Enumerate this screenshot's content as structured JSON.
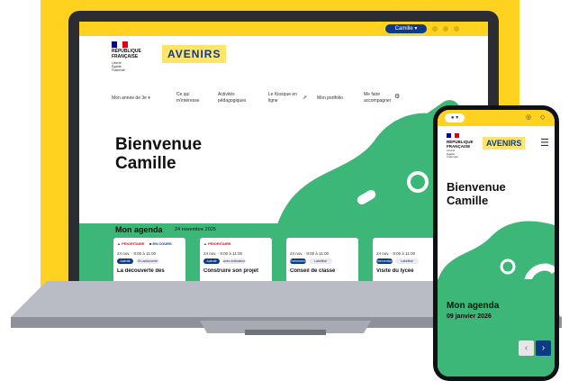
{
  "laptop": {
    "user_chip": "Camille ▾",
    "brand": {
      "line1": "RÉPUBLIQUE",
      "line2": "FRANÇAISE",
      "motto": "Liberté Égalité Fraternité",
      "app_logo": "AVENIRS"
    },
    "nav": {
      "item1": "Mon année de 3e ▾",
      "item2a": "Ce qui",
      "item2b": "m'intéresse",
      "item3a": "Activités",
      "item3b": "pédagogiques",
      "item4a": "Le Kiosque en",
      "item4b": "ligne",
      "item5": "Mon portfolio",
      "item6a": "Me faire",
      "item6b": "accompagner"
    },
    "welcome_line1": "Bienvenue",
    "welcome_line2": "Camille",
    "agenda": {
      "title": "Mon agenda",
      "date": "24 novembre 2025",
      "cards": [
        {
          "tag": "▲ PRIORITAIRE",
          "tag2": "■ EN COURS",
          "time": "24 nov. · 8:00 à 11:00",
          "pill1": "Activité",
          "pill2": "En autonomie",
          "title": "La découverte des"
        },
        {
          "tag": "▲ PRIORITAIRE",
          "tag2": "",
          "time": "24 nov. · 8:00 à 11:00",
          "pill1": "Activité",
          "pill2": "avec ordinateur",
          "title": "Construire son projet"
        },
        {
          "tag": "",
          "tag2": "",
          "time": "24 nov. · 8:00 à 11:00",
          "pill1": "Événement",
          "pill2": "Labellisé",
          "title": "Conseil de classe"
        },
        {
          "tag": "",
          "tag2": "",
          "time": "24 nov. · 8:00 à 11:00",
          "pill1": "Intervention",
          "pill2": "Labellisé",
          "title": "Visite du lycée"
        }
      ]
    }
  },
  "phone": {
    "brand": {
      "line1": "RÉPUBLIQUE",
      "line2": "FRANÇAISE",
      "motto": "Liberté Égalité Fraternité",
      "app_logo": "AVENIRS"
    },
    "welcome_line1": "Bienvenue",
    "welcome_line2": "Camille",
    "agenda_title": "Mon agenda",
    "agenda_date": "09 janvier 2026",
    "prev_glyph": "‹",
    "next_glyph": "›",
    "menu_glyph": "☰"
  },
  "colors": {
    "yellow": "#ffd21f",
    "green": "#3db778",
    "navy": "#0b3b86",
    "red": "#c8102e"
  },
  "icons": {
    "laptop_topbar": [
      "user-icon",
      "settings-icon",
      "notification-icon",
      "help-icon"
    ],
    "phone_topbar": [
      "user-icon",
      "help-icon",
      "notification-icon"
    ]
  }
}
